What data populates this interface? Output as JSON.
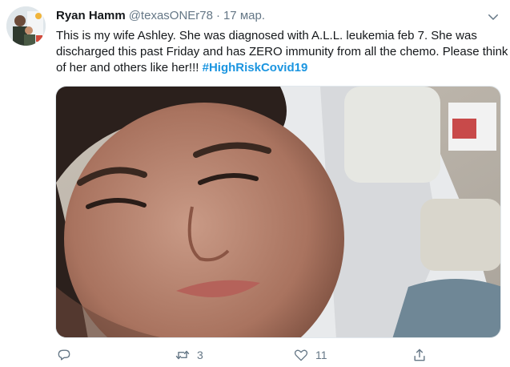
{
  "tweet": {
    "author_name": "Ryan Hamm",
    "handle": "@texasONEr78",
    "separator": "·",
    "date": "17 мар.",
    "text_main": "This is my wife Ashley. She was diagnosed with A.L.L. leukemia feb 7. She was discharged this past Friday and has ZERO immunity from all the chemo. Please think of her and others like her!!! ",
    "hashtag": "#HighRiskCovid19"
  },
  "actions": {
    "reply_count": "",
    "retweet_count": "3",
    "like_count": "11"
  },
  "icons": {
    "reply": "reply-icon",
    "retweet": "retweet-icon",
    "like": "like-icon",
    "share": "share-icon",
    "menu": "chevron-down-icon"
  },
  "colors": {
    "link": "#1b95e0",
    "secondary": "#657786",
    "text": "#14171a"
  }
}
